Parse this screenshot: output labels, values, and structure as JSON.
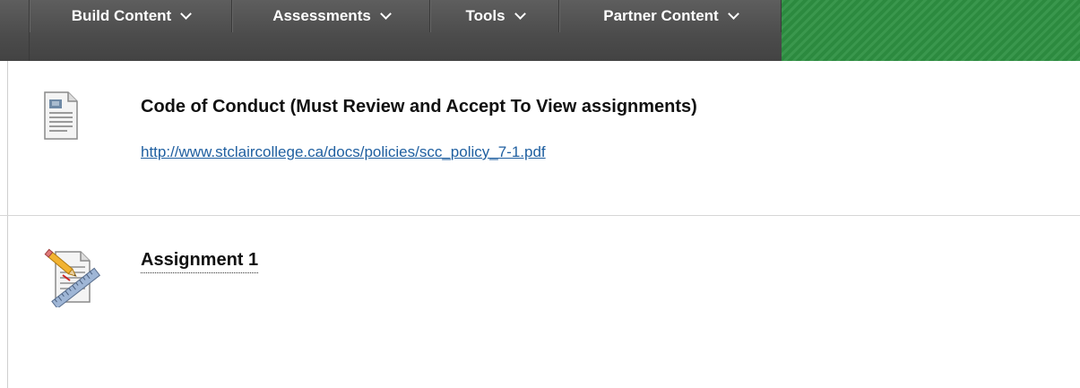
{
  "toolbar": {
    "menus": [
      {
        "label": "Build Content"
      },
      {
        "label": "Assessments"
      },
      {
        "label": "Tools"
      },
      {
        "label": "Partner Content"
      }
    ],
    "accent_color": "#2e9142"
  },
  "items": [
    {
      "title": "Code of Conduct (Must Review and Accept To View assignments)",
      "link": "http://www.stclaircollege.ca/docs/policies/scc_policy_7-1.pdf",
      "icon": "document-icon"
    },
    {
      "title": "Assignment 1",
      "icon": "assignment-icon"
    }
  ]
}
